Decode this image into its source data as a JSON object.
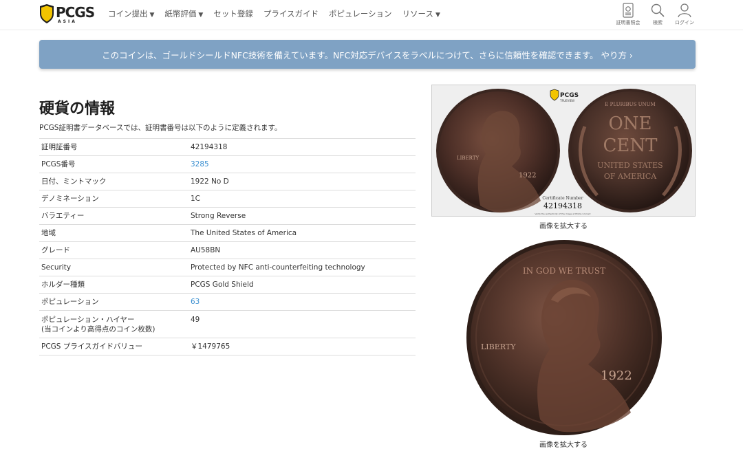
{
  "header": {
    "logo_text": "PCGS",
    "logo_sub": "ASIA",
    "nav": [
      {
        "label": "コイン提出",
        "caret": "▼"
      },
      {
        "label": "紙幣評価",
        "caret": "▼"
      },
      {
        "label": "セット登録",
        "caret": ""
      },
      {
        "label": "プライスガイド",
        "caret": ""
      },
      {
        "label": "ポピュレーション",
        "caret": ""
      },
      {
        "label": "リソース",
        "caret": "▼"
      }
    ],
    "icons": {
      "cert": "証明書照会",
      "search": "検索",
      "login": "ログイン"
    }
  },
  "banner": {
    "text": "このコインは、ゴールドシールドNFC技術を備えています。NFC対応デバイスをラベルにつけて、さらに信頼性を確認できます。 やり方 ›"
  },
  "main": {
    "title": "硬貨の情報",
    "description": "PCGS証明書データベースでは、証明書番号は以下のように定義されます。",
    "rows": [
      {
        "label": "証明証番号",
        "value": "42194318"
      },
      {
        "label": "PCGS番号",
        "value": "3285"
      },
      {
        "label": "日付、ミントマック",
        "value": "1922 No D"
      },
      {
        "label": "デノミネーション",
        "value": "1C"
      },
      {
        "label": "バラエティー",
        "value": "Strong Reverse"
      },
      {
        "label": "地域",
        "value": "The United States of America"
      },
      {
        "label": "グレード",
        "value": "AU58BN"
      },
      {
        "label": "Security",
        "value": "Protected by NFC anti-counterfeiting technology"
      },
      {
        "label": "ホルダー種類",
        "value": "PCGS Gold Shield"
      },
      {
        "label": "ポピュレーション",
        "value": "63"
      },
      {
        "label": "ポピュレーション・ハイヤー",
        "label2": "(当コインより高得点のコイン枚数)",
        "value": "49"
      },
      {
        "label": "PCGS プライスガイドバリュー",
        "value": "￥1479765"
      }
    ]
  },
  "images": {
    "slab_cert_label": "Certificate Number",
    "slab_cert_number": "42194318",
    "slab_verify": "Verify the authenticity of this image at PCGS.com/cert",
    "slab_brand": "PCGS",
    "slab_trueview": "TRUEVIEW",
    "coin_liberty": "LIBERTY",
    "coin_date": "1922",
    "coin_motto": "IN GOD WE TRUST",
    "coin_one": "ONE",
    "coin_cent": "CENT",
    "coin_usa1": "UNITED STATES",
    "coin_usa2": "OF AMERICA",
    "coin_epu": "E PLURIBUS UNUM",
    "enlarge_label": "画像を拡大する",
    "enlarge_label_2": "画像を拡大する"
  },
  "colors": {
    "banner": "#7fa2c4",
    "link": "#3a8fd0",
    "shield": "#f2c400"
  }
}
